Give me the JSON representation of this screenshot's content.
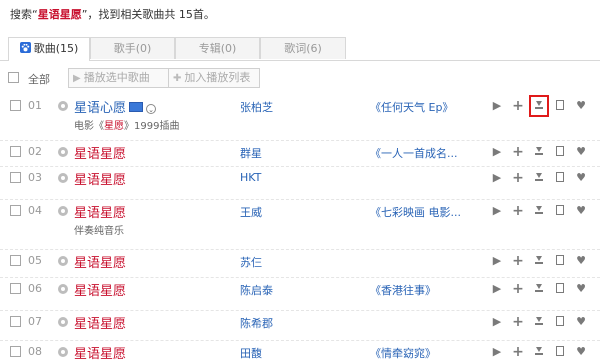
{
  "summary": {
    "prefix": "搜索“",
    "keyword": "星语星愿",
    "suffix": "”，找到相关歌曲共 15首。"
  },
  "tabs": [
    {
      "label": "歌曲(15)",
      "active": true
    },
    {
      "label": "歌手(0)",
      "active": false
    },
    {
      "label": "专辑(0)",
      "active": false
    },
    {
      "label": "歌词(6)",
      "active": false
    }
  ],
  "toolbar": {
    "all_label": "全部",
    "play_selected": "播放选中歌曲",
    "add_to_playlist": "加入播放列表"
  },
  "songs": [
    {
      "num": "01",
      "title": "星语心愿",
      "title_color": "blue",
      "hq": true,
      "more": true,
      "sub_prefix": "电影《",
      "sub_kw": "星愿",
      "sub_suffix": "》1999插曲",
      "artist": "张柏芝",
      "album": "《任何天气 Ep》"
    },
    {
      "num": "02",
      "title": "星语星愿",
      "artist": "群星",
      "album": "《一人一首成名..."
    },
    {
      "num": "03",
      "title": "星语星愿",
      "artist": "HKT",
      "album": ""
    },
    {
      "num": "04",
      "title": "星语星愿",
      "sub_prefix": "伴奏纯音乐",
      "sub_kw": "",
      "sub_suffix": "",
      "artist": "王威",
      "album": "《七彩映画 电影..."
    },
    {
      "num": "05",
      "title": "星语星愿",
      "artist": "苏仨",
      "album": ""
    },
    {
      "num": "06",
      "title": "星语星愿",
      "artist": "陈启泰",
      "album": "《香港往事》"
    },
    {
      "num": "07",
      "title": "星语星愿",
      "artist": "陈希郡",
      "album": ""
    },
    {
      "num": "08",
      "title": "星语星愿",
      "artist": "田馥",
      "album": "《情牵窈窕》"
    }
  ],
  "actions": {
    "play_icon": "play-icon",
    "add_icon": "plus-icon",
    "download_icon": "download-icon",
    "bookmark_icon": "bookmark-icon",
    "favorite_icon": "heart-icon",
    "highlighted_download_row": "01"
  },
  "colors": {
    "keyword_red": "#c8102e",
    "link_blue": "#2a64b6",
    "highlight_box": "#e01a1a"
  }
}
